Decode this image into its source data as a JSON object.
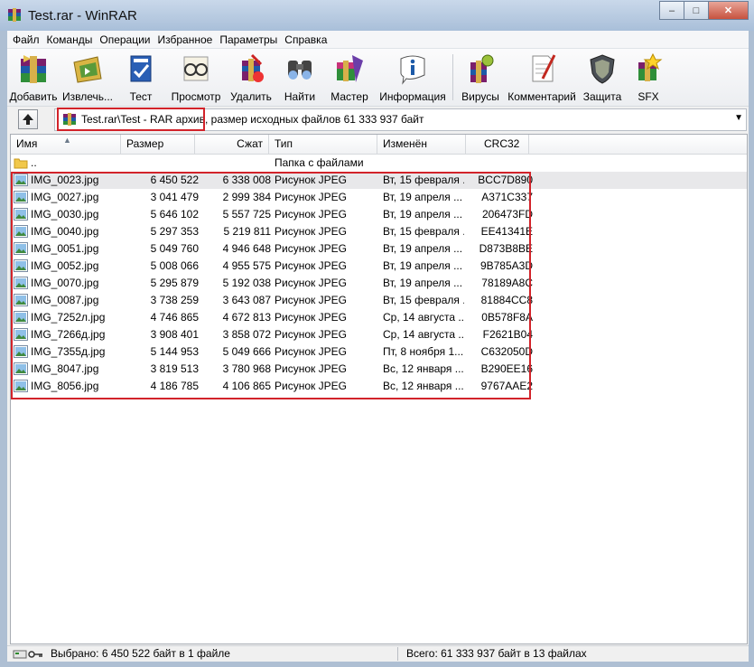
{
  "window": {
    "title": "Test.rar - WinRAR",
    "minimize": "–",
    "maximize": "□",
    "close": "✕"
  },
  "menu": [
    "Файл",
    "Команды",
    "Операции",
    "Избранное",
    "Параметры",
    "Справка"
  ],
  "toolbar": [
    {
      "label": "Добавить",
      "icon": "add-archive-icon"
    },
    {
      "label": "Извлечь...",
      "icon": "extract-icon"
    },
    {
      "label": "Тест",
      "icon": "test-icon"
    },
    {
      "label": "Просмотр",
      "icon": "view-icon"
    },
    {
      "label": "Удалить",
      "icon": "delete-icon"
    },
    {
      "label": "Найти",
      "icon": "find-icon"
    },
    {
      "label": "Мастер",
      "icon": "wizard-icon"
    },
    {
      "label": "Информация",
      "icon": "info-icon"
    },
    {
      "label": "Вирусы",
      "icon": "virus-scan-icon"
    },
    {
      "label": "Комментарий",
      "icon": "comment-icon"
    },
    {
      "label": "Защита",
      "icon": "protect-icon"
    },
    {
      "label": "SFX",
      "icon": "sfx-icon"
    }
  ],
  "address": {
    "text": "Test.rar\\Test - RAR архив, размер исходных файлов 61 333 937 байт"
  },
  "columns": {
    "name": "Имя",
    "size": "Размер",
    "packed": "Сжат",
    "type": "Тип",
    "modified": "Изменён",
    "crc": "CRC32"
  },
  "parent_row": {
    "name": "..",
    "type": "Папка с файлами"
  },
  "files": [
    {
      "name": "IMG_0023.jpg",
      "size": "6 450 522",
      "packed": "6 338 008",
      "type": "Рисунок JPEG",
      "modified": "Вт, 15 февраля ...",
      "crc": "BCC7D890"
    },
    {
      "name": "IMG_0027.jpg",
      "size": "3 041 479",
      "packed": "2 999 384",
      "type": "Рисунок JPEG",
      "modified": "Вт, 19 апреля ...",
      "crc": "A371C337"
    },
    {
      "name": "IMG_0030.jpg",
      "size": "5 646 102",
      "packed": "5 557 725",
      "type": "Рисунок JPEG",
      "modified": "Вт, 19 апреля ...",
      "crc": "206473FD"
    },
    {
      "name": "IMG_0040.jpg",
      "size": "5 297 353",
      "packed": "5 219 811",
      "type": "Рисунок JPEG",
      "modified": "Вт, 15 февраля ...",
      "crc": "EE41341E"
    },
    {
      "name": "IMG_0051.jpg",
      "size": "5 049 760",
      "packed": "4 946 648",
      "type": "Рисунок JPEG",
      "modified": "Вт, 19 апреля ...",
      "crc": "D873B8BE"
    },
    {
      "name": "IMG_0052.jpg",
      "size": "5 008 066",
      "packed": "4 955 575",
      "type": "Рисунок JPEG",
      "modified": "Вт, 19 апреля ...",
      "crc": "9B785A3D"
    },
    {
      "name": "IMG_0070.jpg",
      "size": "5 295 879",
      "packed": "5 192 038",
      "type": "Рисунок JPEG",
      "modified": "Вт, 19 апреля ...",
      "crc": "78189A8C"
    },
    {
      "name": "IMG_0087.jpg",
      "size": "3 738 259",
      "packed": "3 643 087",
      "type": "Рисунок JPEG",
      "modified": "Вт, 15 февраля ...",
      "crc": "81884CC8"
    },
    {
      "name": "IMG_7252л.jpg",
      "size": "4 746 865",
      "packed": "4 672 813",
      "type": "Рисунок JPEG",
      "modified": "Ср, 14 августа ...",
      "crc": "0B578F8A"
    },
    {
      "name": "IMG_7266д.jpg",
      "size": "3 908 401",
      "packed": "3 858 072",
      "type": "Рисунок JPEG",
      "modified": "Ср, 14 августа ...",
      "crc": "F2621B04"
    },
    {
      "name": "IMG_7355д.jpg",
      "size": "5 144 953",
      "packed": "5 049 666",
      "type": "Рисунок JPEG",
      "modified": "Пт, 8 ноября 1...",
      "crc": "C632050D"
    },
    {
      "name": "IMG_8047.jpg",
      "size": "3 819 513",
      "packed": "3 780 968",
      "type": "Рисунок JPEG",
      "modified": "Вс, 12 января ...",
      "crc": "B290EE16"
    },
    {
      "name": "IMG_8056.jpg",
      "size": "4 186 785",
      "packed": "4 106 865",
      "type": "Рисунок JPEG",
      "modified": "Вс, 12 января ...",
      "crc": "9767AAE2"
    }
  ],
  "status": {
    "selected": "Выбрано: 6 450 522 байт в 1 файле",
    "total": "Всего: 61 333 937 байт в 13 файлах"
  },
  "colors": {
    "highlight": "#d2232a",
    "selection": "#e8e8ea"
  }
}
